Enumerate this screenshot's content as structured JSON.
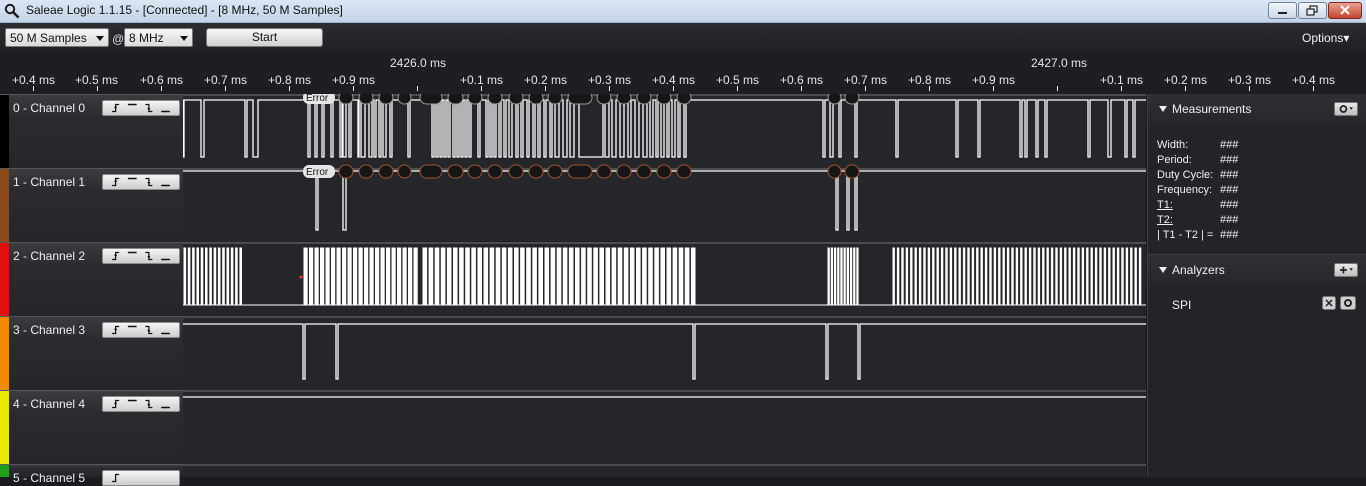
{
  "window": {
    "title": "Saleae Logic 1.1.15 - [Connected] - [8 MHz, 50 M Samples]"
  },
  "toolbar": {
    "samples_value": "50 M Samples",
    "at_label": "@",
    "rate_value": "8 MHz",
    "start_label": "Start",
    "options_label": "Options▾"
  },
  "ruler": {
    "major_labels": [
      "2426.0 ms",
      "2427.0 ms"
    ],
    "ticks": [
      "+0.4 ms",
      "+0.5 ms",
      "+0.6 ms",
      "+0.7 ms",
      "+0.8 ms",
      "+0.9 ms",
      "+0.1 ms",
      "+0.2 ms",
      "+0.3 ms",
      "+0.4 ms",
      "+0.5 ms",
      "+0.6 ms",
      "+0.7 ms",
      "+0.8 ms",
      "+0.9 ms",
      "+0.1 ms",
      "+0.2 ms",
      "+0.3 ms",
      "+0.4 ms"
    ]
  },
  "channels": [
    {
      "label": "0 - Channel 0",
      "color": "#000000"
    },
    {
      "label": "1 - Channel 1",
      "color": "#8b4a1c"
    },
    {
      "label": "2 - Channel 2",
      "color": "#e01010"
    },
    {
      "label": "3 - Channel 3",
      "color": "#f08a00"
    },
    {
      "label": "4 - Channel 4",
      "color": "#e8e800"
    },
    {
      "label": "5 - Channel 5",
      "color": "#1ea01e"
    }
  ],
  "decoder": {
    "error_label": "Error"
  },
  "measurements": {
    "title": "Measurements",
    "rows": [
      {
        "label": "Width:",
        "value": "###"
      },
      {
        "label": "Period:",
        "value": "###"
      },
      {
        "label": "Duty Cycle:",
        "value": "###"
      },
      {
        "label": "Frequency:",
        "value": "###"
      },
      {
        "label": "T1:",
        "value": "###"
      },
      {
        "label": "T2:",
        "value": "###"
      },
      {
        "label": "| T1 - T2 | =",
        "value": "###"
      }
    ]
  },
  "analyzers": {
    "title": "Analyzers",
    "items": [
      "SPI"
    ]
  }
}
